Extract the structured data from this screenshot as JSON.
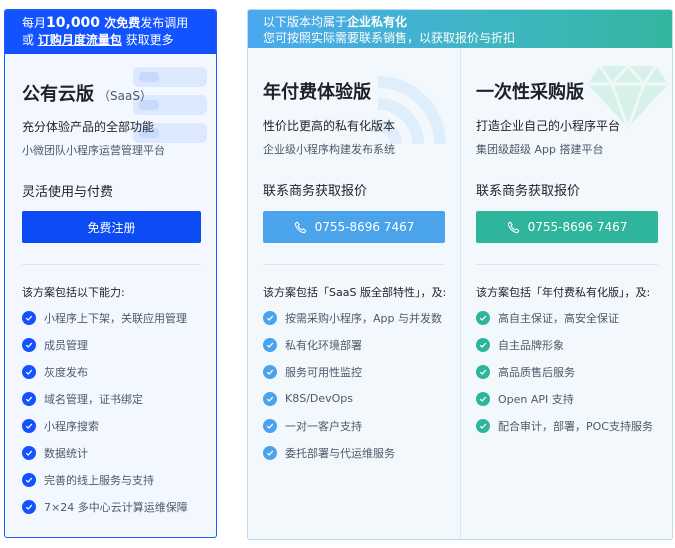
{
  "saas": {
    "banner": {
      "prefix": "每月",
      "count": "10,000",
      "free": " 次免费",
      "suffix": "发布调用",
      "line2_prefix": "或 ",
      "link": "订购月度流量包",
      "line2_suffix": " 获取更多"
    },
    "title": "公有云版",
    "title_sub": "（SaaS）",
    "desc": "充分体验产品的全部功能",
    "desc2": "小微团队小程序运营管理平台",
    "price_label": "灵活使用与付费",
    "cta_label": "免费注册",
    "features_heading": "该方案包括以下能力:",
    "features": [
      "小程序上下架，关联应用管理",
      "成员管理",
      "灰度发布",
      "域名管理，证书绑定",
      "小程序搜索",
      "数据统计",
      "完善的线上服务与支持",
      "7×24 多中心云计算运维保障"
    ],
    "accent": "#1352ff"
  },
  "private": {
    "banner": {
      "line1_prefix": "以下版本均属于",
      "line1_bold": "企业私有化",
      "line2": "您可按照实际需要联系销售，以获取报价与折扣"
    },
    "annual": {
      "title": "年付费体验版",
      "desc": "性价比更高的私有化版本",
      "desc2": "企业级小程序构建发布系统",
      "price_label": "联系商务获取报价",
      "phone": "0755-8696 7467",
      "features_heading": "该方案包括「SaaS 版全部特性」，及:",
      "features": [
        "按需采购小程序，App 与并发数",
        "私有化环境部署",
        "服务可用性监控",
        "K8S/DevOps",
        "一对一客户支持",
        "委托部署与代运维服务"
      ],
      "accent": "#4ba3ec"
    },
    "onetime": {
      "title": "一次性采购版",
      "desc": "打造企业自己的小程序平台",
      "desc2": "集团级超级 App 搭建平台",
      "price_label": "联系商务获取报价",
      "phone": "0755-8696 7467",
      "features_heading": "该方案包括「年付费私有化版」，及:",
      "features": [
        "高自主保证，高安全保证",
        "自主品牌形象",
        "高品质售后服务",
        "Open API 支持",
        "配合审计，部署，POC支持服务"
      ],
      "accent": "#2fb59c"
    }
  },
  "icons": {
    "check": "check-circle-icon",
    "phone": "phone-icon",
    "saas_decoration": "server-stack-icon",
    "annual_decoration": "wifi-signal-icon",
    "onetime_decoration": "diamond-icon"
  }
}
